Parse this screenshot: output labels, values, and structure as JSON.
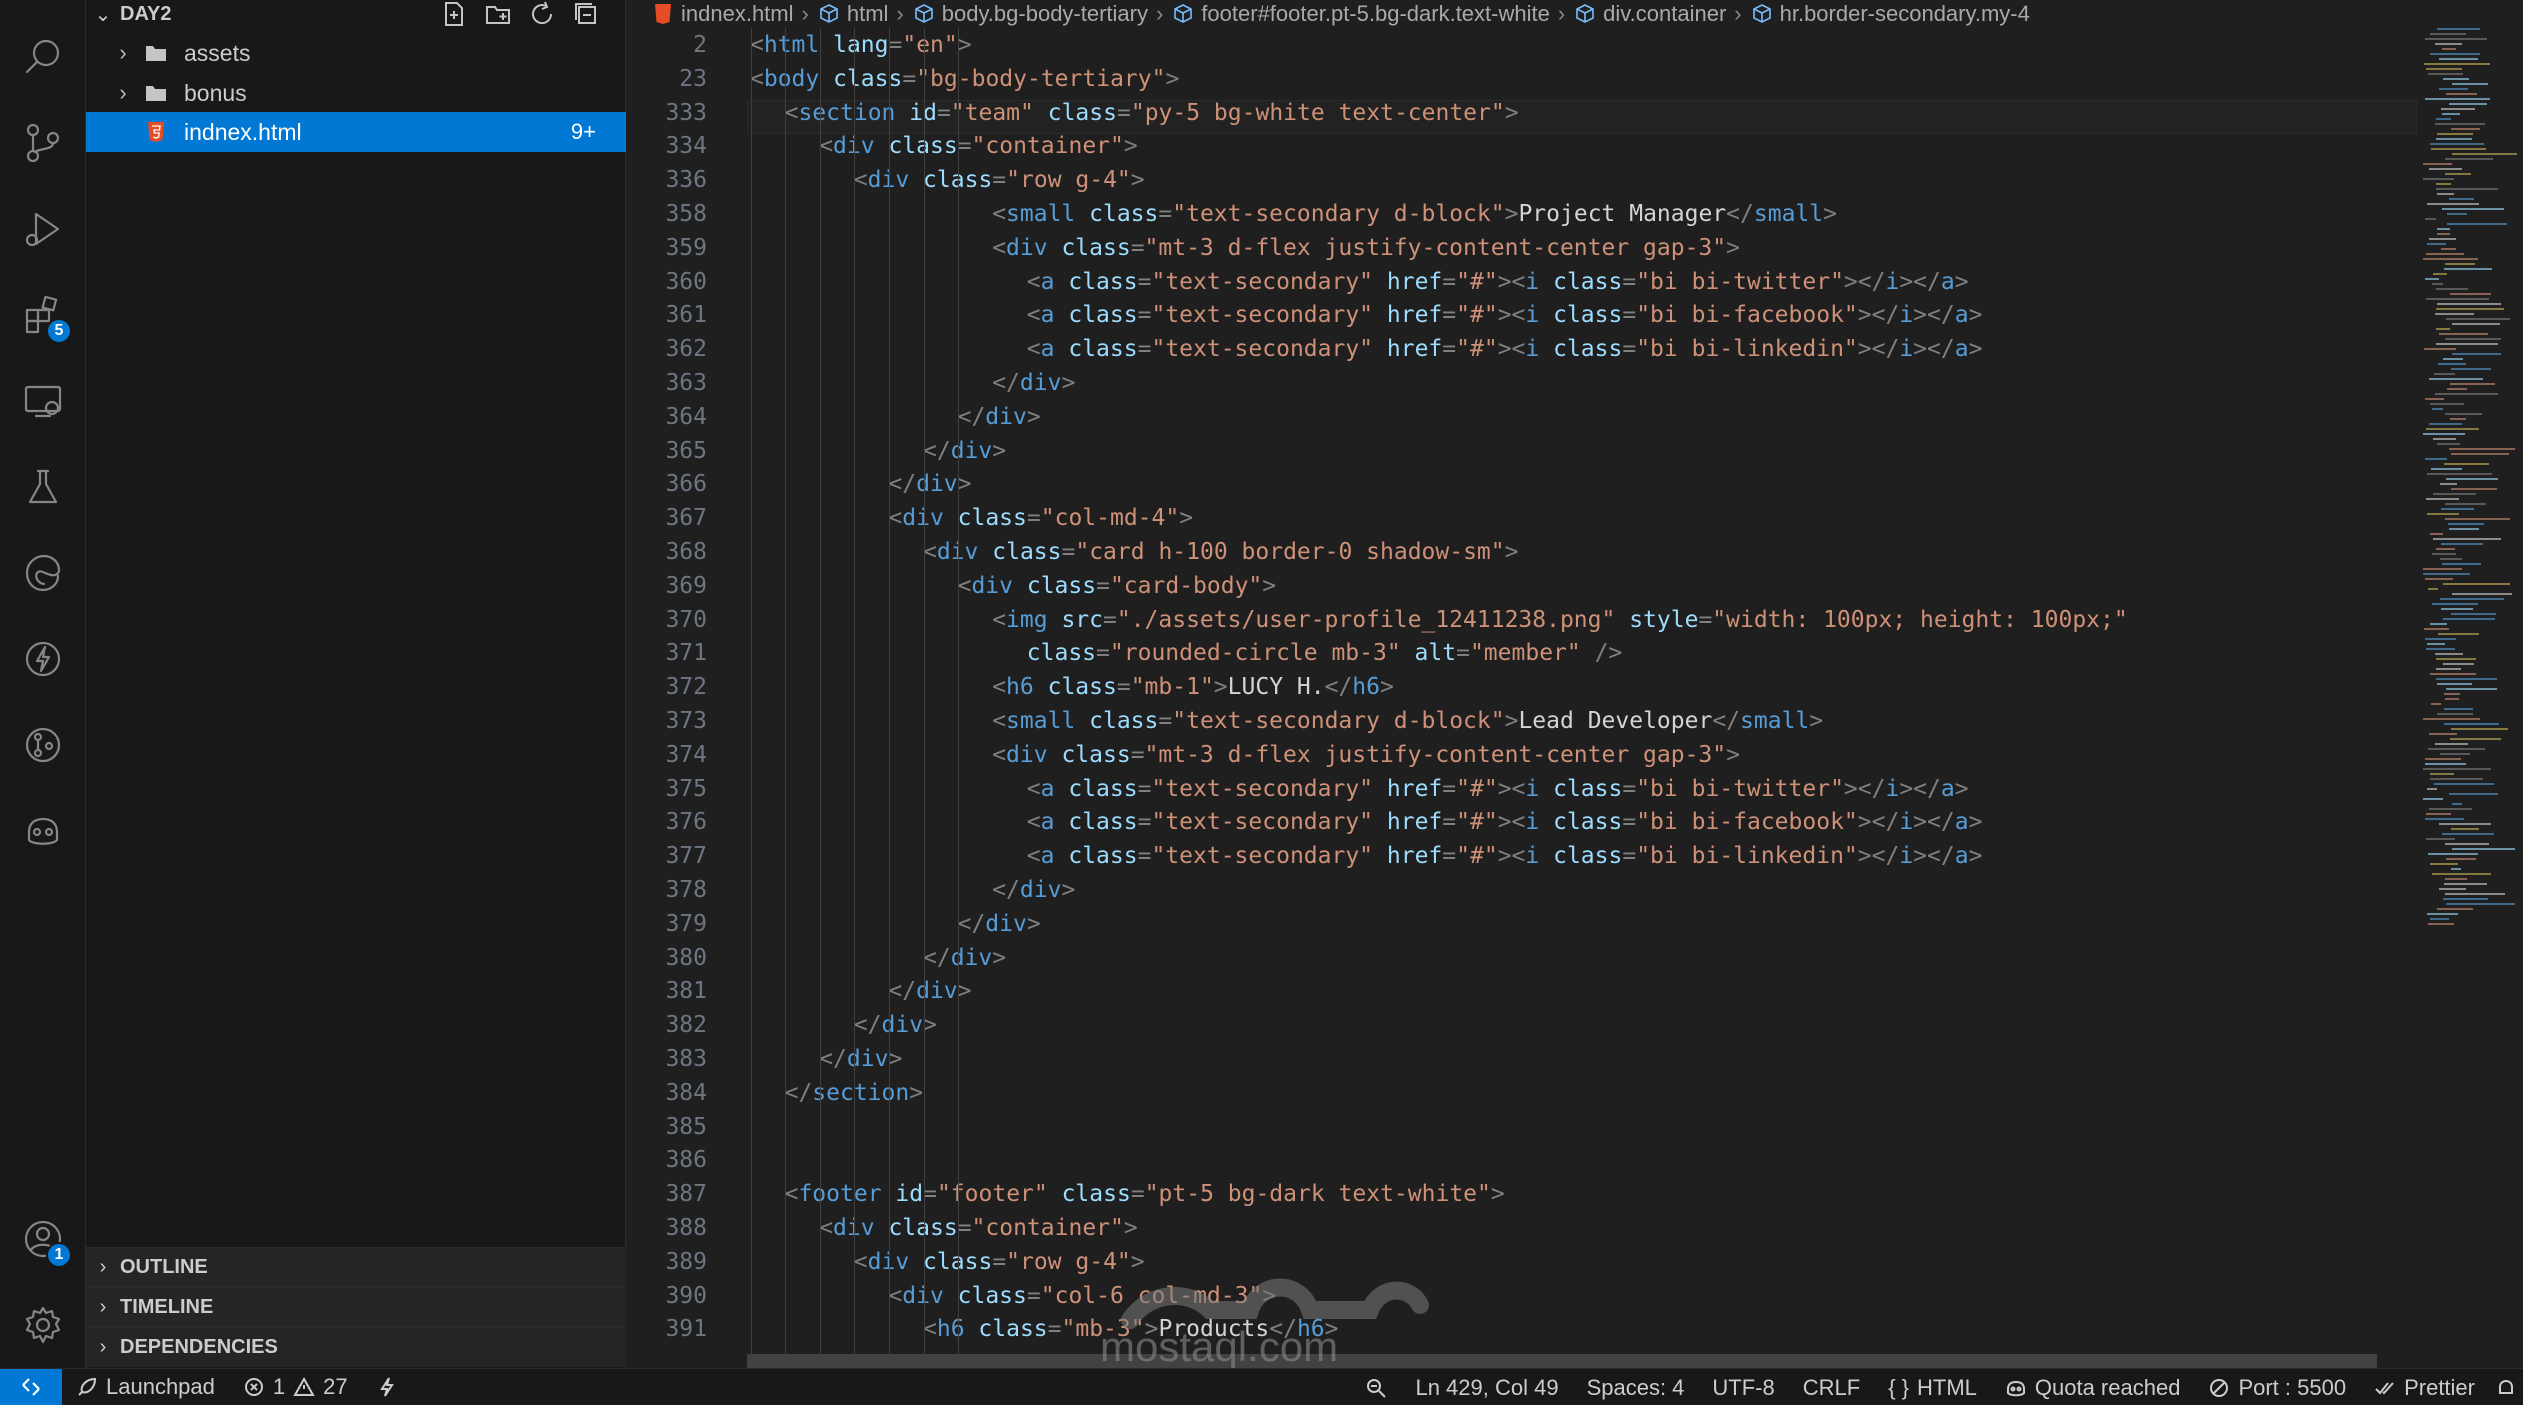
{
  "explorer": {
    "folder": "DAY2",
    "items": [
      {
        "name": "assets",
        "type": "folder"
      },
      {
        "name": "bonus",
        "type": "folder"
      },
      {
        "name": "indnex.html",
        "type": "file",
        "badge": "9+"
      }
    ],
    "panels": [
      "OUTLINE",
      "TIMELINE",
      "DEPENDENCIES"
    ]
  },
  "activity": {
    "extensions_badge": "5",
    "accounts_badge": "1"
  },
  "breadcrumb": [
    "indnex.html",
    "html",
    "body.bg-body-tertiary",
    "footer#footer.pt-5.bg-dark.text-white",
    "div.container",
    "hr.border-secondary.my-4"
  ],
  "code_lines": [
    {
      "n": "2",
      "indent": 0,
      "tokens": [
        [
          "p",
          "<"
        ],
        [
          "t",
          "html"
        ],
        [
          "a",
          " lang"
        ],
        [
          "p",
          "="
        ],
        [
          "s",
          "\"en\""
        ],
        [
          "p",
          ">"
        ]
      ]
    },
    {
      "n": "23",
      "indent": 0,
      "tokens": [
        [
          "p",
          "<"
        ],
        [
          "t",
          "body"
        ],
        [
          "a",
          " class"
        ],
        [
          "p",
          "="
        ],
        [
          "s",
          "\"bg-body-tertiary\""
        ],
        [
          "p",
          ">"
        ]
      ]
    },
    {
      "n": "333",
      "indent": 1,
      "tokens": [
        [
          "p",
          "<"
        ],
        [
          "t",
          "section"
        ],
        [
          "a",
          " id"
        ],
        [
          "p",
          "="
        ],
        [
          "s",
          "\"team\""
        ],
        [
          "a",
          " class"
        ],
        [
          "p",
          "="
        ],
        [
          "s",
          "\"py-5 bg-white text-center\""
        ],
        [
          "p",
          ">"
        ]
      ]
    },
    {
      "n": "334",
      "indent": 2,
      "tokens": [
        [
          "p",
          "<"
        ],
        [
          "t",
          "div"
        ],
        [
          "a",
          " class"
        ],
        [
          "p",
          "="
        ],
        [
          "s",
          "\"container\""
        ],
        [
          "p",
          ">"
        ]
      ]
    },
    {
      "n": "336",
      "indent": 3,
      "tokens": [
        [
          "p",
          "<"
        ],
        [
          "t",
          "div"
        ],
        [
          "a",
          " class"
        ],
        [
          "p",
          "="
        ],
        [
          "s",
          "\"row g-4\""
        ],
        [
          "p",
          ">"
        ]
      ]
    },
    {
      "n": "358",
      "indent": 7,
      "tokens": [
        [
          "p",
          "<"
        ],
        [
          "t",
          "small"
        ],
        [
          "a",
          " class"
        ],
        [
          "p",
          "="
        ],
        [
          "s",
          "\"text-secondary d-block\""
        ],
        [
          "p",
          ">"
        ],
        [
          "x",
          "Project Manager"
        ],
        [
          "p",
          "</"
        ],
        [
          "t",
          "small"
        ],
        [
          "p",
          ">"
        ]
      ]
    },
    {
      "n": "359",
      "indent": 7,
      "tokens": [
        [
          "p",
          "<"
        ],
        [
          "t",
          "div"
        ],
        [
          "a",
          " class"
        ],
        [
          "p",
          "="
        ],
        [
          "s",
          "\"mt-3 d-flex justify-content-center gap-3\""
        ],
        [
          "p",
          ">"
        ]
      ]
    },
    {
      "n": "360",
      "indent": 8,
      "tokens": [
        [
          "p",
          "<"
        ],
        [
          "t",
          "a"
        ],
        [
          "a",
          " class"
        ],
        [
          "p",
          "="
        ],
        [
          "s",
          "\"text-secondary\""
        ],
        [
          "a",
          " href"
        ],
        [
          "p",
          "="
        ],
        [
          "s",
          "\"#\""
        ],
        [
          "p",
          "><"
        ],
        [
          "t",
          "i"
        ],
        [
          "a",
          " class"
        ],
        [
          "p",
          "="
        ],
        [
          "s",
          "\"bi bi-twitter\""
        ],
        [
          "p",
          "></"
        ],
        [
          "t",
          "i"
        ],
        [
          "p",
          "></"
        ],
        [
          "t",
          "a"
        ],
        [
          "p",
          ">"
        ]
      ]
    },
    {
      "n": "361",
      "indent": 8,
      "tokens": [
        [
          "p",
          "<"
        ],
        [
          "t",
          "a"
        ],
        [
          "a",
          " class"
        ],
        [
          "p",
          "="
        ],
        [
          "s",
          "\"text-secondary\""
        ],
        [
          "a",
          " href"
        ],
        [
          "p",
          "="
        ],
        [
          "s",
          "\"#\""
        ],
        [
          "p",
          "><"
        ],
        [
          "t",
          "i"
        ],
        [
          "a",
          " class"
        ],
        [
          "p",
          "="
        ],
        [
          "s",
          "\"bi bi-facebook\""
        ],
        [
          "p",
          "></"
        ],
        [
          "t",
          "i"
        ],
        [
          "p",
          "></"
        ],
        [
          "t",
          "a"
        ],
        [
          "p",
          ">"
        ]
      ]
    },
    {
      "n": "362",
      "indent": 8,
      "tokens": [
        [
          "p",
          "<"
        ],
        [
          "t",
          "a"
        ],
        [
          "a",
          " class"
        ],
        [
          "p",
          "="
        ],
        [
          "s",
          "\"text-secondary\""
        ],
        [
          "a",
          " href"
        ],
        [
          "p",
          "="
        ],
        [
          "s",
          "\"#\""
        ],
        [
          "p",
          "><"
        ],
        [
          "t",
          "i"
        ],
        [
          "a",
          " class"
        ],
        [
          "p",
          "="
        ],
        [
          "s",
          "\"bi bi-linkedin\""
        ],
        [
          "p",
          "></"
        ],
        [
          "t",
          "i"
        ],
        [
          "p",
          "></"
        ],
        [
          "t",
          "a"
        ],
        [
          "p",
          ">"
        ]
      ]
    },
    {
      "n": "363",
      "indent": 7,
      "tokens": [
        [
          "p",
          "</"
        ],
        [
          "t",
          "div"
        ],
        [
          "p",
          ">"
        ]
      ]
    },
    {
      "n": "364",
      "indent": 6,
      "tokens": [
        [
          "p",
          "</"
        ],
        [
          "t",
          "div"
        ],
        [
          "p",
          ">"
        ]
      ]
    },
    {
      "n": "365",
      "indent": 5,
      "tokens": [
        [
          "p",
          "</"
        ],
        [
          "t",
          "div"
        ],
        [
          "p",
          ">"
        ]
      ]
    },
    {
      "n": "366",
      "indent": 4,
      "tokens": [
        [
          "p",
          "</"
        ],
        [
          "t",
          "div"
        ],
        [
          "p",
          ">"
        ]
      ]
    },
    {
      "n": "367",
      "indent": 4,
      "tokens": [
        [
          "p",
          "<"
        ],
        [
          "t",
          "div"
        ],
        [
          "a",
          " class"
        ],
        [
          "p",
          "="
        ],
        [
          "s",
          "\"col-md-4\""
        ],
        [
          "p",
          ">"
        ]
      ]
    },
    {
      "n": "368",
      "indent": 5,
      "tokens": [
        [
          "p",
          "<"
        ],
        [
          "t",
          "div"
        ],
        [
          "a",
          " class"
        ],
        [
          "p",
          "="
        ],
        [
          "s",
          "\"card h-100 border-0 shadow-sm\""
        ],
        [
          "p",
          ">"
        ]
      ]
    },
    {
      "n": "369",
      "indent": 6,
      "tokens": [
        [
          "p",
          "<"
        ],
        [
          "t",
          "div"
        ],
        [
          "a",
          " class"
        ],
        [
          "p",
          "="
        ],
        [
          "s",
          "\"card-body\""
        ],
        [
          "p",
          ">"
        ]
      ]
    },
    {
      "n": "370",
      "indent": 7,
      "tokens": [
        [
          "p",
          "<"
        ],
        [
          "t",
          "img"
        ],
        [
          "a",
          " src"
        ],
        [
          "p",
          "="
        ],
        [
          "s",
          "\"./assets/user-profile_12411238.png\""
        ],
        [
          "a",
          " style"
        ],
        [
          "p",
          "="
        ],
        [
          "s",
          "\"width: 100px; height: 100px;\""
        ]
      ]
    },
    {
      "n": "371",
      "indent": 8,
      "tokens": [
        [
          "a",
          "class"
        ],
        [
          "p",
          "="
        ],
        [
          "s",
          "\"rounded-circle mb-3\""
        ],
        [
          "a",
          " alt"
        ],
        [
          "p",
          "="
        ],
        [
          "s",
          "\"member\""
        ],
        [
          "p",
          " />"
        ]
      ]
    },
    {
      "n": "372",
      "indent": 7,
      "tokens": [
        [
          "p",
          "<"
        ],
        [
          "t",
          "h6"
        ],
        [
          "a",
          " class"
        ],
        [
          "p",
          "="
        ],
        [
          "s",
          "\"mb-1\""
        ],
        [
          "p",
          ">"
        ],
        [
          "x",
          "LUCY H."
        ],
        [
          "p",
          "</"
        ],
        [
          "t",
          "h6"
        ],
        [
          "p",
          ">"
        ]
      ]
    },
    {
      "n": "373",
      "indent": 7,
      "tokens": [
        [
          "p",
          "<"
        ],
        [
          "t",
          "small"
        ],
        [
          "a",
          " class"
        ],
        [
          "p",
          "="
        ],
        [
          "s",
          "\"text-secondary d-block\""
        ],
        [
          "p",
          ">"
        ],
        [
          "x",
          "Lead Developer"
        ],
        [
          "p",
          "</"
        ],
        [
          "t",
          "small"
        ],
        [
          "p",
          ">"
        ]
      ]
    },
    {
      "n": "374",
      "indent": 7,
      "tokens": [
        [
          "p",
          "<"
        ],
        [
          "t",
          "div"
        ],
        [
          "a",
          " class"
        ],
        [
          "p",
          "="
        ],
        [
          "s",
          "\"mt-3 d-flex justify-content-center gap-3\""
        ],
        [
          "p",
          ">"
        ]
      ]
    },
    {
      "n": "375",
      "indent": 8,
      "tokens": [
        [
          "p",
          "<"
        ],
        [
          "t",
          "a"
        ],
        [
          "a",
          " class"
        ],
        [
          "p",
          "="
        ],
        [
          "s",
          "\"text-secondary\""
        ],
        [
          "a",
          " href"
        ],
        [
          "p",
          "="
        ],
        [
          "s",
          "\"#\""
        ],
        [
          "p",
          "><"
        ],
        [
          "t",
          "i"
        ],
        [
          "a",
          " class"
        ],
        [
          "p",
          "="
        ],
        [
          "s",
          "\"bi bi-twitter\""
        ],
        [
          "p",
          "></"
        ],
        [
          "t",
          "i"
        ],
        [
          "p",
          "></"
        ],
        [
          "t",
          "a"
        ],
        [
          "p",
          ">"
        ]
      ]
    },
    {
      "n": "376",
      "indent": 8,
      "tokens": [
        [
          "p",
          "<"
        ],
        [
          "t",
          "a"
        ],
        [
          "a",
          " class"
        ],
        [
          "p",
          "="
        ],
        [
          "s",
          "\"text-secondary\""
        ],
        [
          "a",
          " href"
        ],
        [
          "p",
          "="
        ],
        [
          "s",
          "\"#\""
        ],
        [
          "p",
          "><"
        ],
        [
          "t",
          "i"
        ],
        [
          "a",
          " class"
        ],
        [
          "p",
          "="
        ],
        [
          "s",
          "\"bi bi-facebook\""
        ],
        [
          "p",
          "></"
        ],
        [
          "t",
          "i"
        ],
        [
          "p",
          "></"
        ],
        [
          "t",
          "a"
        ],
        [
          "p",
          ">"
        ]
      ]
    },
    {
      "n": "377",
      "indent": 8,
      "tokens": [
        [
          "p",
          "<"
        ],
        [
          "t",
          "a"
        ],
        [
          "a",
          " class"
        ],
        [
          "p",
          "="
        ],
        [
          "s",
          "\"text-secondary\""
        ],
        [
          "a",
          " href"
        ],
        [
          "p",
          "="
        ],
        [
          "s",
          "\"#\""
        ],
        [
          "p",
          "><"
        ],
        [
          "t",
          "i"
        ],
        [
          "a",
          " class"
        ],
        [
          "p",
          "="
        ],
        [
          "s",
          "\"bi bi-linkedin\""
        ],
        [
          "p",
          "></"
        ],
        [
          "t",
          "i"
        ],
        [
          "p",
          "></"
        ],
        [
          "t",
          "a"
        ],
        [
          "p",
          ">"
        ]
      ]
    },
    {
      "n": "378",
      "indent": 7,
      "tokens": [
        [
          "p",
          "</"
        ],
        [
          "t",
          "div"
        ],
        [
          "p",
          ">"
        ]
      ]
    },
    {
      "n": "379",
      "indent": 6,
      "tokens": [
        [
          "p",
          "</"
        ],
        [
          "t",
          "div"
        ],
        [
          "p",
          ">"
        ]
      ]
    },
    {
      "n": "380",
      "indent": 5,
      "tokens": [
        [
          "p",
          "</"
        ],
        [
          "t",
          "div"
        ],
        [
          "p",
          ">"
        ]
      ]
    },
    {
      "n": "381",
      "indent": 4,
      "tokens": [
        [
          "p",
          "</"
        ],
        [
          "t",
          "div"
        ],
        [
          "p",
          ">"
        ]
      ]
    },
    {
      "n": "382",
      "indent": 3,
      "tokens": [
        [
          "p",
          "</"
        ],
        [
          "t",
          "div"
        ],
        [
          "p",
          ">"
        ]
      ]
    },
    {
      "n": "383",
      "indent": 2,
      "tokens": [
        [
          "p",
          "</"
        ],
        [
          "t",
          "div"
        ],
        [
          "p",
          ">"
        ]
      ]
    },
    {
      "n": "384",
      "indent": 1,
      "tokens": [
        [
          "p",
          "</"
        ],
        [
          "t",
          "section"
        ],
        [
          "p",
          ">"
        ]
      ]
    },
    {
      "n": "385",
      "indent": 0,
      "tokens": []
    },
    {
      "n": "386",
      "indent": 0,
      "tokens": []
    },
    {
      "n": "387",
      "indent": 1,
      "tokens": [
        [
          "p",
          "<"
        ],
        [
          "t",
          "footer"
        ],
        [
          "a",
          " id"
        ],
        [
          "p",
          "="
        ],
        [
          "s",
          "\"footer\""
        ],
        [
          "a",
          " class"
        ],
        [
          "p",
          "="
        ],
        [
          "s",
          "\"pt-5 bg-dark text-white\""
        ],
        [
          "p",
          ">"
        ]
      ]
    },
    {
      "n": "388",
      "indent": 2,
      "tokens": [
        [
          "p",
          "<"
        ],
        [
          "t",
          "div"
        ],
        [
          "a",
          " class"
        ],
        [
          "p",
          "="
        ],
        [
          "s",
          "\"container\""
        ],
        [
          "p",
          ">"
        ]
      ]
    },
    {
      "n": "389",
      "indent": 3,
      "tokens": [
        [
          "p",
          "<"
        ],
        [
          "t",
          "div"
        ],
        [
          "a",
          " class"
        ],
        [
          "p",
          "="
        ],
        [
          "s",
          "\"row g-4\""
        ],
        [
          "p",
          ">"
        ]
      ]
    },
    {
      "n": "390",
      "indent": 4,
      "tokens": [
        [
          "p",
          "<"
        ],
        [
          "t",
          "div"
        ],
        [
          "a",
          " class"
        ],
        [
          "p",
          "="
        ],
        [
          "s",
          "\"col-6 col-md-3\""
        ],
        [
          "p",
          ">"
        ]
      ]
    },
    {
      "n": "391",
      "indent": 5,
      "tokens": [
        [
          "p",
          "<"
        ],
        [
          "t",
          "h6"
        ],
        [
          "a",
          " class"
        ],
        [
          "p",
          "="
        ],
        [
          "s",
          "\"mb-3\""
        ],
        [
          "p",
          ">"
        ],
        [
          "x",
          "Products"
        ],
        [
          "p",
          "</"
        ],
        [
          "t",
          "h6"
        ],
        [
          "p",
          ">"
        ]
      ]
    }
  ],
  "status": {
    "launchpad": "Launchpad",
    "errors": "1",
    "warnings": "27",
    "position": "Ln 429, Col 49",
    "spaces": "Spaces: 4",
    "encoding": "UTF-8",
    "eol": "CRLF",
    "language": "HTML",
    "quota": "Quota reached",
    "port": "Port : 5500",
    "prettier": "Prettier"
  },
  "watermark": {
    "text": "mostaql.com"
  },
  "colors": {
    "accent": "#0078d4",
    "tag": "#569cd6",
    "attr": "#9cdcfe",
    "string": "#ce9178"
  }
}
